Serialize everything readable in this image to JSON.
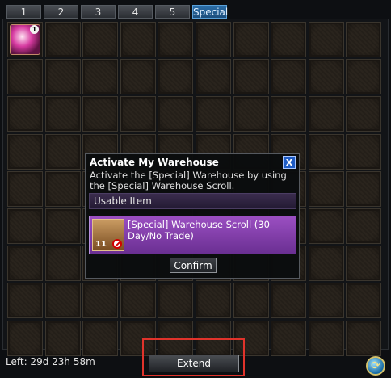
{
  "tabs": [
    "1",
    "2",
    "3",
    "4",
    "5",
    "Special"
  ],
  "grid": {
    "first_item_count": "1"
  },
  "dialog": {
    "title": "Activate My Warehouse",
    "description": "Activate the [Special] Warehouse by using the [Special] Warehouse Scroll.",
    "usable_header": "Usable Item",
    "scroll_name": "[Special] Warehouse Scroll (30 Day/No Trade)",
    "scroll_count": "11",
    "confirm_label": "Confirm",
    "close_label": "X"
  },
  "footer": {
    "left_time": "Left: 29d 23h 58m",
    "extend_label": "Extend"
  },
  "icons": {
    "refresh": "refresh-icon"
  },
  "colors": {
    "active_tab": "#2b6ea8",
    "highlight_frame": "#e0332b",
    "item_highlight": "#9b4fc2"
  }
}
